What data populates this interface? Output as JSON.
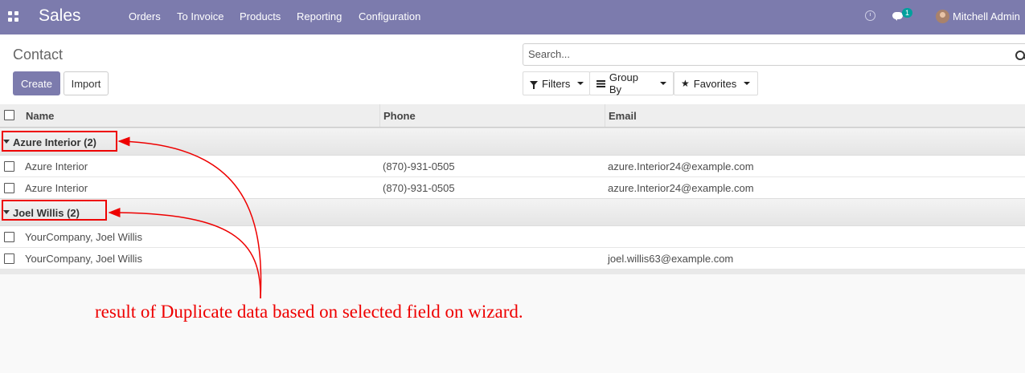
{
  "navbar": {
    "app_name": "Sales",
    "menu": [
      "Orders",
      "To Invoice",
      "Products",
      "Reporting",
      "Configuration"
    ],
    "chat_badge": "1",
    "user_name": "Mitchell Admin"
  },
  "control": {
    "breadcrumb": "Contact",
    "create_label": "Create",
    "import_label": "Import",
    "search_placeholder": "Search...",
    "filters_label": "Filters",
    "groupby_label": "Group By",
    "favorites_label": "Favorites"
  },
  "table": {
    "columns": [
      "Name",
      "Phone",
      "Email"
    ],
    "groups": [
      {
        "label": "Azure Interior (2)",
        "rows": [
          {
            "name": "Azure Interior",
            "phone": "(870)-931-0505",
            "email": "azure.Interior24@example.com"
          },
          {
            "name": "Azure Interior",
            "phone": "(870)-931-0505",
            "email": "azure.Interior24@example.com"
          }
        ]
      },
      {
        "label": "Joel Willis (2)",
        "rows": [
          {
            "name": "YourCompany, Joel Willis",
            "phone": "",
            "email": ""
          },
          {
            "name": "YourCompany, Joel Willis",
            "phone": "",
            "email": "joel.willis63@example.com"
          }
        ]
      }
    ]
  },
  "annotation": "result of Duplicate data based on selected field on wizard.",
  "colors": {
    "brand": "#7c7bad",
    "annotation": "#e00000",
    "badge": "#00a09d"
  }
}
